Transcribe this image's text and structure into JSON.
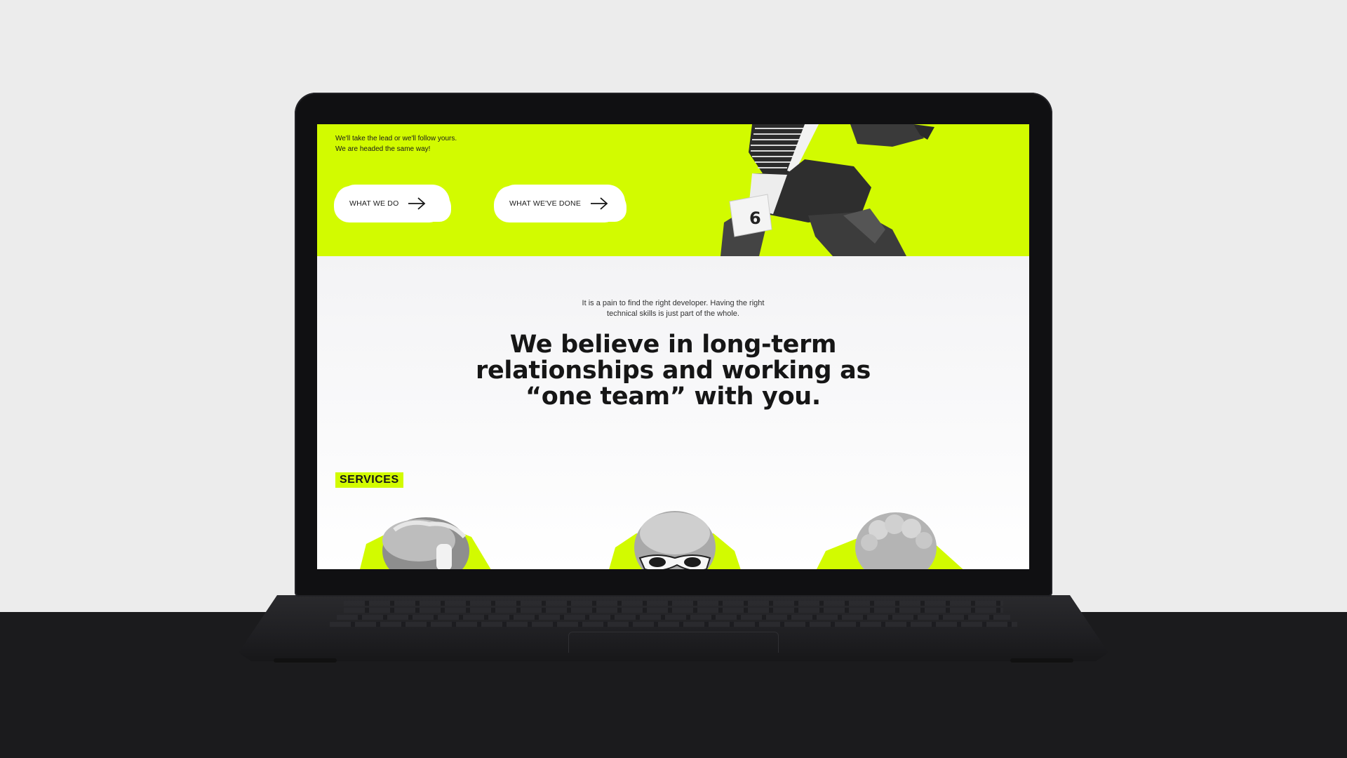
{
  "hero": {
    "tagline": [
      "We'll take the lead or we'll follow yours.",
      "We are headed the same way!"
    ],
    "cta_primary": "WHAT WE DO",
    "cta_secondary": "WHAT WE'VE DONE",
    "runner_bib": "6"
  },
  "intro": {
    "lines": [
      "It is a pain to find the right developer. Having the right",
      "technical skills is just part of the whole."
    ]
  },
  "headline": {
    "line1": "We believe in long-term",
    "line2": "relationships and working as",
    "line3_open_quote": "“",
    "line3_highlight": "one team",
    "line3_rest": "” with you."
  },
  "services": {
    "label": "SERVICES"
  },
  "colors": {
    "accent": "#d2fb00",
    "text": "#161616",
    "device": "#101012"
  },
  "icons": [
    "arrow-right-icon",
    "arrow-right-icon"
  ]
}
